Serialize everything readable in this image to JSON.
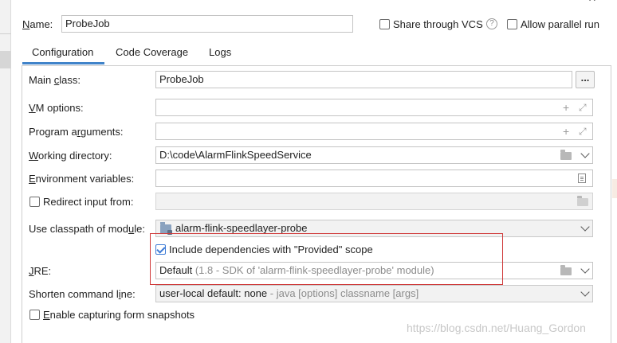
{
  "header": {
    "name_label": "Name:",
    "name_value": "ProbeJob",
    "share_vcs_label": "Share through VCS",
    "share_vcs_checked": false,
    "allow_parallel_label": "Allow parallel run",
    "allow_parallel_checked": false
  },
  "tabs": [
    {
      "label": "Configuration",
      "active": true
    },
    {
      "label": "Code Coverage",
      "active": false
    },
    {
      "label": "Logs",
      "active": false
    }
  ],
  "form": {
    "main_class_label": "Main class:",
    "main_class_value": "ProbeJob",
    "vm_options_label": "VM options:",
    "vm_options_value": "",
    "program_args_label": "Program arguments:",
    "program_args_value": "",
    "working_dir_label": "Working directory:",
    "working_dir_value": "D:\\code\\AlarmFlinkSpeedService",
    "env_vars_label": "Environment variables:",
    "env_vars_value": "",
    "redirect_input_label": "Redirect input from:",
    "redirect_input_checked": false,
    "classpath_label": "Use classpath of module:",
    "classpath_value": "alarm-flink-speedlayer-probe",
    "include_provided_label": "Include dependencies with \"Provided\" scope",
    "include_provided_checked": true,
    "jre_label": "JRE:",
    "jre_value_main": "Default",
    "jre_value_detail": "(1.8 - SDK of 'alarm-flink-speedlayer-probe' module)",
    "shorten_label": "Shorten command line:",
    "shorten_value_main": "user-local default: none",
    "shorten_value_detail": "- java [options] classname [args]",
    "enable_snapshots_label": "Enable capturing form snapshots",
    "enable_snapshots_checked": false
  },
  "watermark": "https://blog.csdn.net/Huang_Gordon",
  "colors": {
    "accent": "#4083c9",
    "annotation_box": "#d03a3a",
    "checkbox_checked": "#3d7bd6"
  }
}
